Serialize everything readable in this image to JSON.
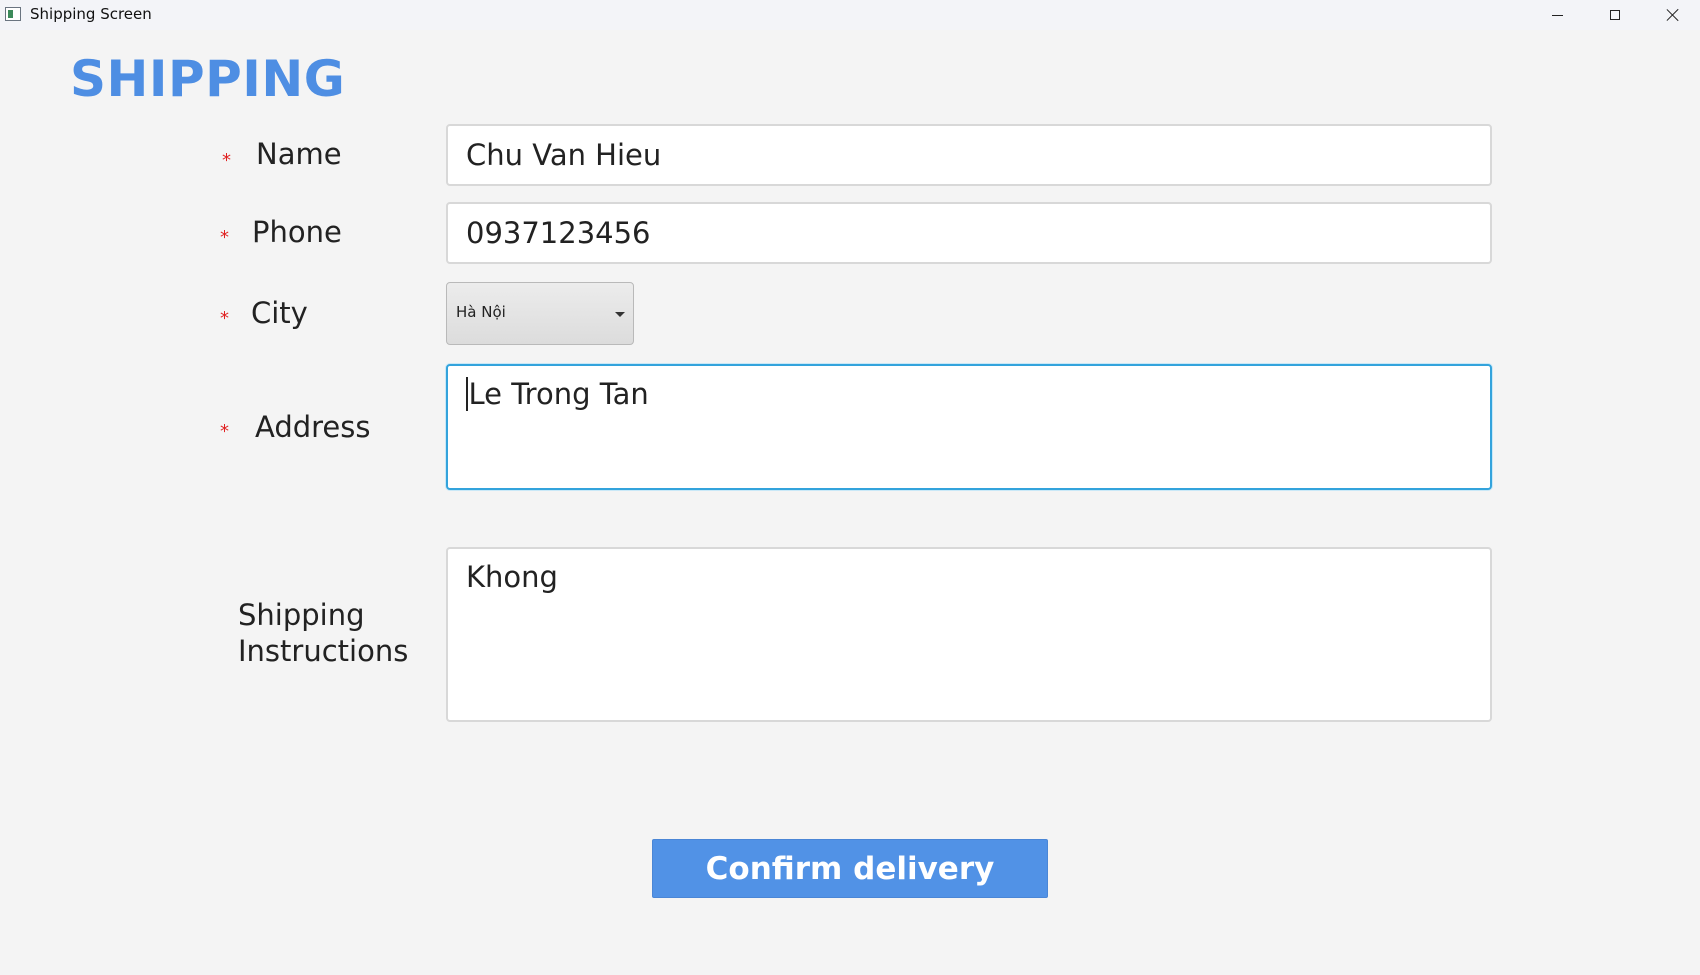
{
  "window": {
    "title": "Shipping Screen"
  },
  "page": {
    "title": "SHIPPING"
  },
  "form": {
    "required_mark": "*",
    "name": {
      "label": "Name",
      "value": "Chu Van Hieu"
    },
    "phone": {
      "label": "Phone",
      "value": "0937123456"
    },
    "city": {
      "label": "City",
      "selected": "Hà Nội"
    },
    "address": {
      "label": "Address",
      "value": "Le Trong Tan"
    },
    "instructions": {
      "label_line1": "Shipping",
      "label_line2": "Instructions",
      "value": "Khong"
    }
  },
  "actions": {
    "confirm_label": "Confirm delivery"
  },
  "colors": {
    "accent": "#4e8ee3",
    "button": "#5192e6",
    "required": "#e02020",
    "focus_border": "#33a3dc"
  },
  "icons": {
    "app": "app-window-icon",
    "minimize": "minimize-icon",
    "maximize": "maximize-icon",
    "close": "close-icon",
    "dropdown": "chevron-down-icon"
  }
}
